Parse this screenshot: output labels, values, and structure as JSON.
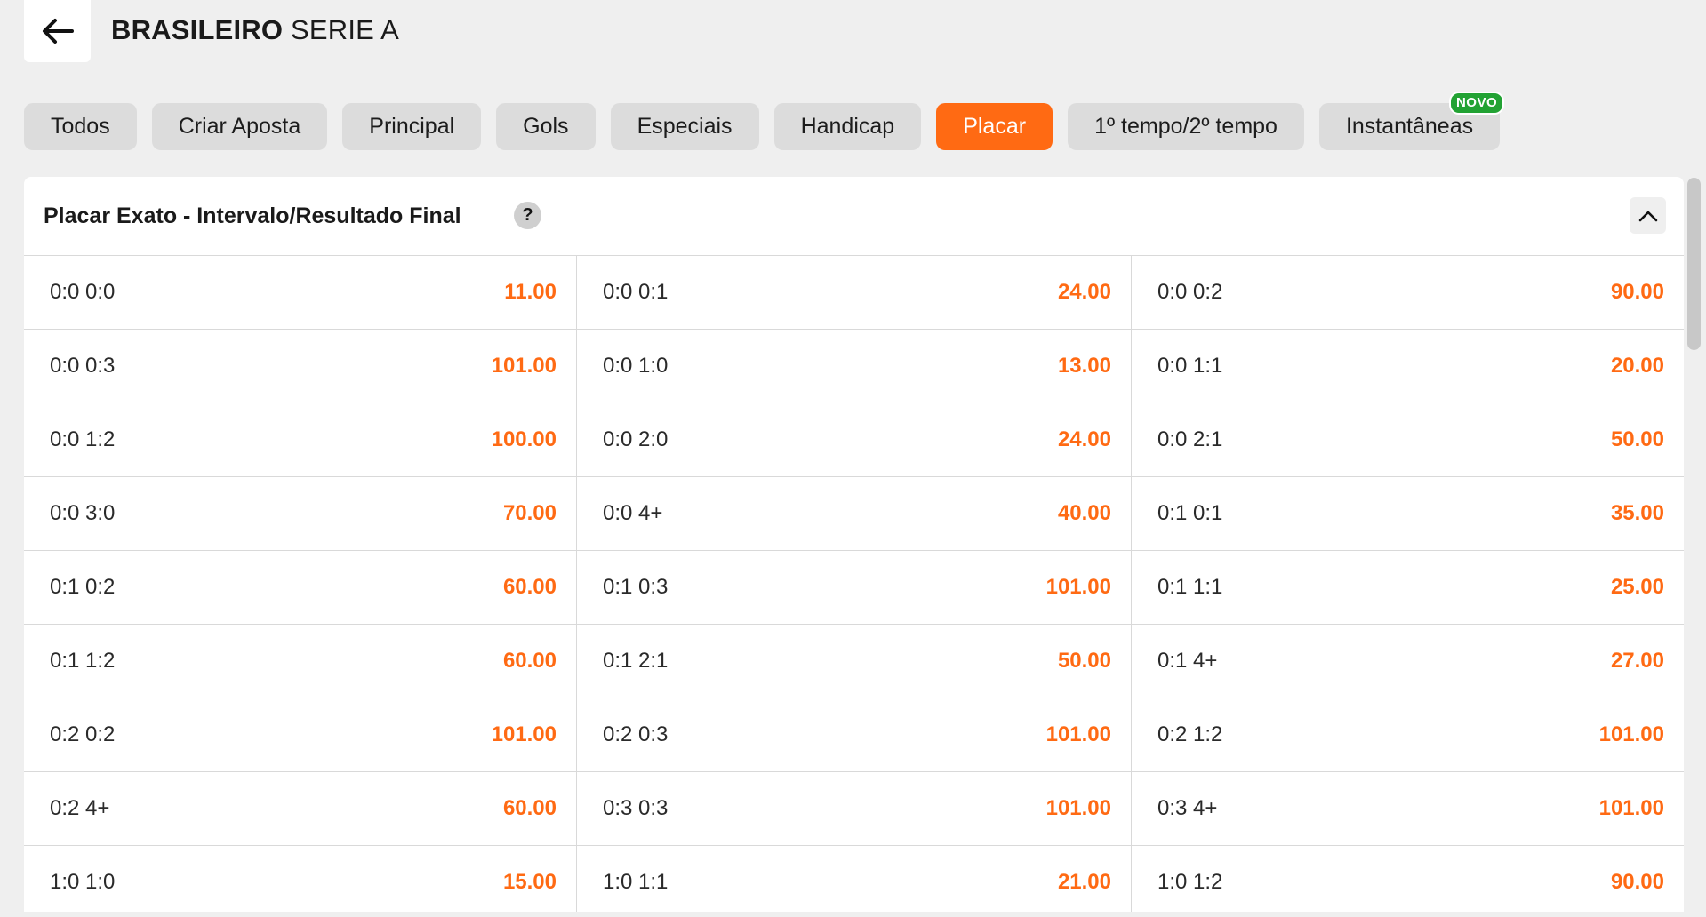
{
  "header": {
    "league_bold": "BRASILEIRO",
    "league_rest": " SERIE A"
  },
  "tabs": [
    {
      "label": "Todos",
      "active": false
    },
    {
      "label": "Criar Aposta",
      "active": false
    },
    {
      "label": "Principal",
      "active": false
    },
    {
      "label": "Gols",
      "active": false
    },
    {
      "label": "Especiais",
      "active": false
    },
    {
      "label": "Handicap",
      "active": false
    },
    {
      "label": "Placar",
      "active": true
    },
    {
      "label": "1º tempo/2º tempo",
      "active": false
    },
    {
      "label": "Instantâneas",
      "active": false,
      "badge": "NOVO"
    }
  ],
  "market": {
    "title": "Placar Exato - Intervalo/Resultado Final",
    "help": "?",
    "rows": [
      [
        {
          "score": "0:0 0:0",
          "odd": "11.00"
        },
        {
          "score": "0:0 0:1",
          "odd": "24.00"
        },
        {
          "score": "0:0 0:2",
          "odd": "90.00"
        }
      ],
      [
        {
          "score": "0:0 0:3",
          "odd": "101.00"
        },
        {
          "score": "0:0 1:0",
          "odd": "13.00"
        },
        {
          "score": "0:0 1:1",
          "odd": "20.00"
        }
      ],
      [
        {
          "score": "0:0 1:2",
          "odd": "100.00"
        },
        {
          "score": "0:0 2:0",
          "odd": "24.00"
        },
        {
          "score": "0:0 2:1",
          "odd": "50.00"
        }
      ],
      [
        {
          "score": "0:0 3:0",
          "odd": "70.00"
        },
        {
          "score": "0:0 4+",
          "odd": "40.00"
        },
        {
          "score": "0:1 0:1",
          "odd": "35.00"
        }
      ],
      [
        {
          "score": "0:1 0:2",
          "odd": "60.00"
        },
        {
          "score": "0:1 0:3",
          "odd": "101.00"
        },
        {
          "score": "0:1 1:1",
          "odd": "25.00"
        }
      ],
      [
        {
          "score": "0:1 1:2",
          "odd": "60.00"
        },
        {
          "score": "0:1 2:1",
          "odd": "50.00"
        },
        {
          "score": "0:1 4+",
          "odd": "27.00"
        }
      ],
      [
        {
          "score": "0:2 0:2",
          "odd": "101.00"
        },
        {
          "score": "0:2 0:3",
          "odd": "101.00"
        },
        {
          "score": "0:2 1:2",
          "odd": "101.00"
        }
      ],
      [
        {
          "score": "0:2 4+",
          "odd": "60.00"
        },
        {
          "score": "0:3 0:3",
          "odd": "101.00"
        },
        {
          "score": "0:3 4+",
          "odd": "101.00"
        }
      ],
      [
        {
          "score": "1:0 1:0",
          "odd": "15.00"
        },
        {
          "score": "1:0 1:1",
          "odd": "21.00"
        },
        {
          "score": "1:0 1:2",
          "odd": "90.00"
        }
      ]
    ]
  },
  "colors": {
    "accent": "#ff6a13",
    "badge": "#22a233",
    "tab_bg": "#dcdcdc",
    "page_bg": "#efefef"
  },
  "icons": {
    "back": "arrow-left-icon",
    "collapse": "chevron-up-icon",
    "help": "question-icon"
  }
}
